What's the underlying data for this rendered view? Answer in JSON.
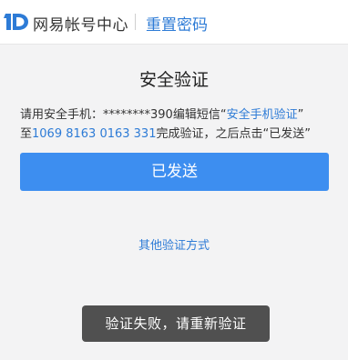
{
  "header": {
    "brand": "网易帐号中心",
    "page_name": "重置密码",
    "logo_icon": "1d-logo-icon"
  },
  "verification": {
    "title": "安全验证",
    "line1_prefix": "请用安全手机：",
    "masked_phone": "********390",
    "line1_mid": "编辑短信“",
    "sms_content": "安全手机验证",
    "line1_suffix": "”",
    "line2_prefix": "至",
    "target_number": "1069 8163 0163 331",
    "line2_mid": "完成验证，之后点击“",
    "line2_action": "已发送",
    "line2_suffix": "”"
  },
  "sent_button": {
    "label": "已发送"
  },
  "other_methods": {
    "label": "其他验证方式"
  },
  "toast": {
    "message": "验证失败，请重新验证"
  },
  "colors": {
    "accent": "#3d8ef0",
    "link": "#2d7bd6",
    "toast_bg": "#505050",
    "page_bg": "#f3f3f4"
  }
}
